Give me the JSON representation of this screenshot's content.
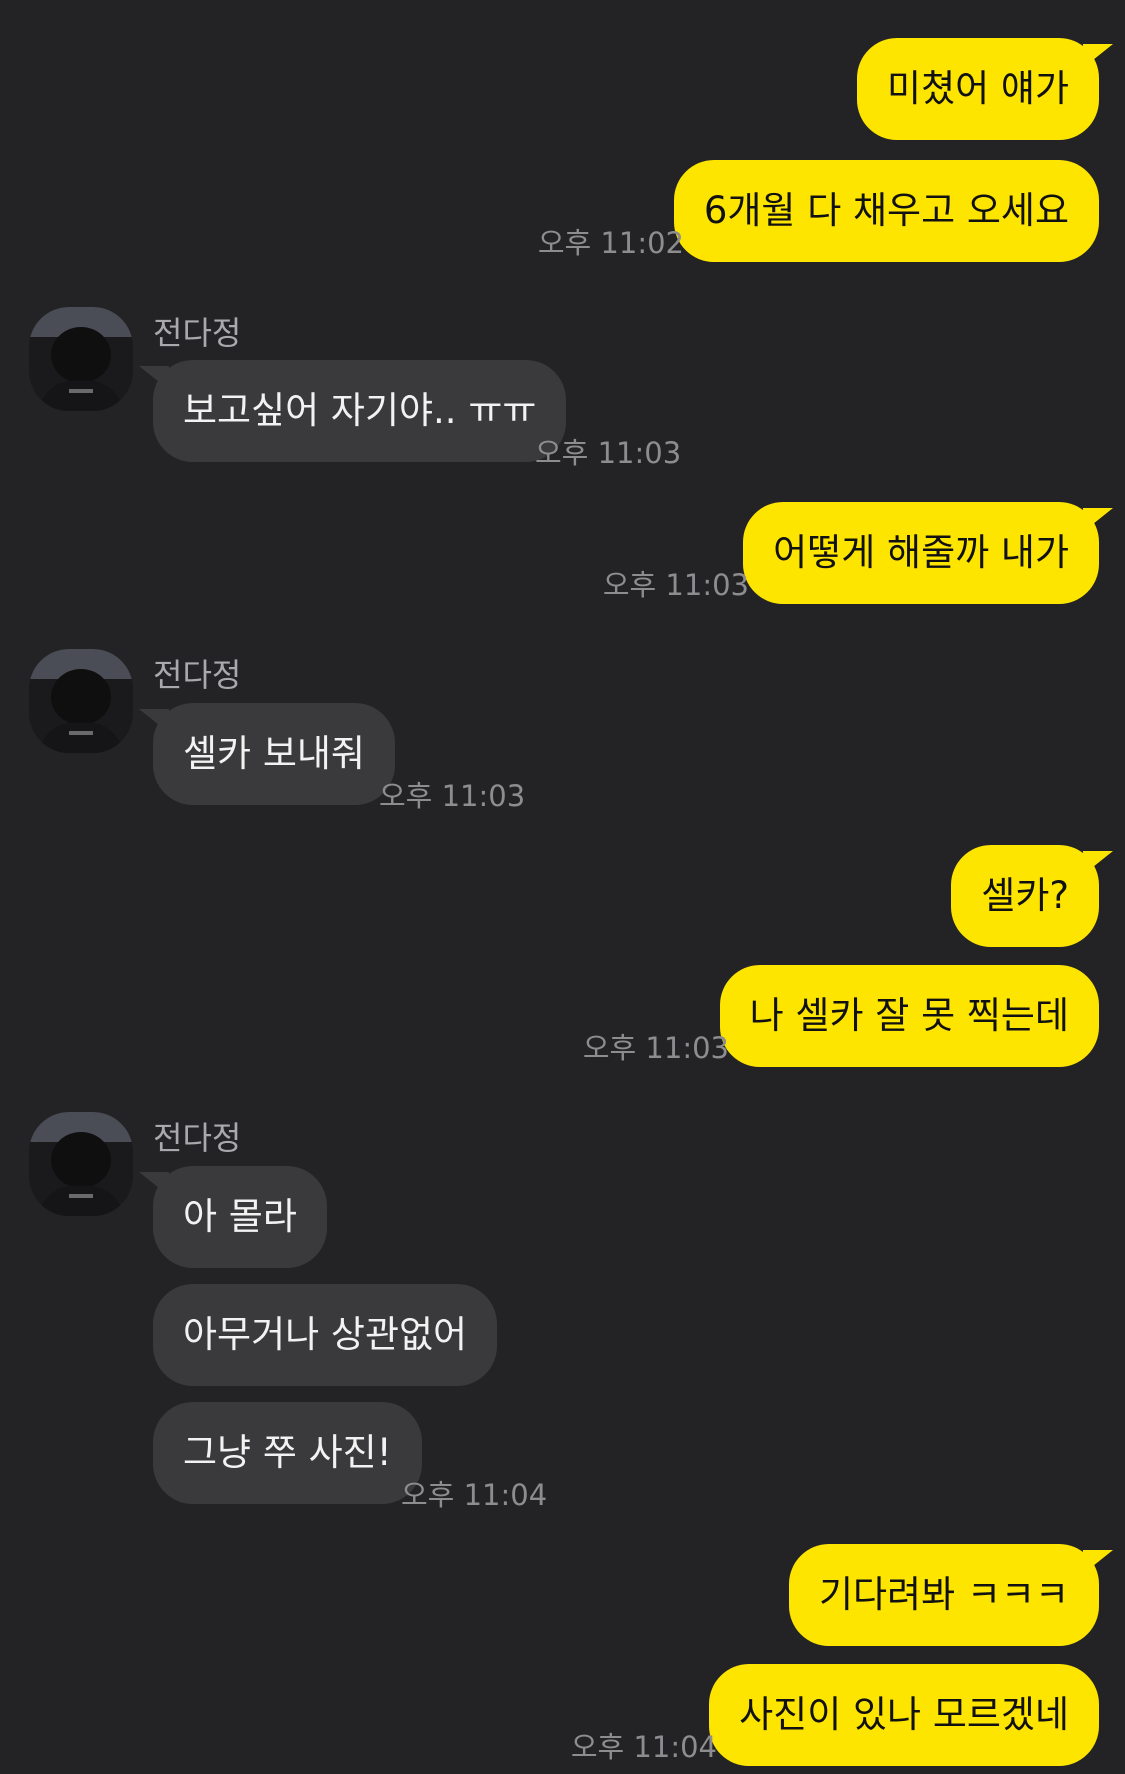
{
  "contact": {
    "name": "전다정"
  },
  "messages": [
    {
      "text": "미쳤어 얘가"
    },
    {
      "text": "6개월 다 채우고 오세요",
      "time": "오후 11:02"
    },
    {
      "text": "보고싶어 자기야.. ㅠㅠ",
      "time": "오후 11:03"
    },
    {
      "text": "어떻게 해줄까 내가",
      "time": "오후 11:03"
    },
    {
      "text": "셀카 보내줘",
      "time": "오후 11:03"
    },
    {
      "text": "셀카?"
    },
    {
      "text": "나 셀카 잘 못 찍는데",
      "time": "오후 11:03"
    },
    {
      "text": "아 몰라"
    },
    {
      "text": "아무거나 상관없어"
    },
    {
      "text": "그냥 쭈 사진!",
      "time": "오후 11:04"
    },
    {
      "text": "기다려봐 ㅋㅋㅋ"
    },
    {
      "text": "사진이 있나 모르겠네",
      "time": "오후 11:04"
    }
  ],
  "colors": {
    "my_bubble": "#FEE500",
    "their_bubble": "#3A3A3C",
    "background": "#232325"
  }
}
